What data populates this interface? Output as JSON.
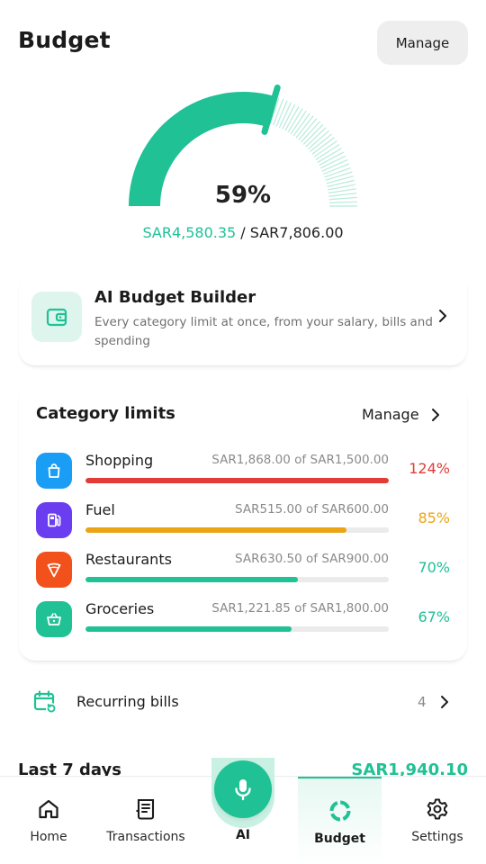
{
  "header": {
    "title": "Budget",
    "manage_label": "Manage"
  },
  "summary": {
    "percent_label": "59%",
    "percent_value": 0.59,
    "spent": "SAR4,580.35",
    "separator": " / ",
    "total": "SAR7,806.00"
  },
  "ai_builder": {
    "icon": "wallet-icon",
    "title": "AI Budget Builder",
    "description": "Every category limit at once, from your salary, bills and spending"
  },
  "categories": {
    "title": "Category limits",
    "manage_label": "Manage",
    "items": [
      {
        "name": "Shopping",
        "amount": "SAR1,868.00 of SAR1,500.00",
        "percent": "124%",
        "progress": 1.0,
        "icon": "shopping-bag-icon",
        "icon_color": "#1a9df5",
        "bar_color": "#e33b36",
        "pct_color": "#e33b36"
      },
      {
        "name": "Fuel",
        "amount": "SAR515.00 of SAR600.00",
        "percent": "85%",
        "progress": 0.86,
        "icon": "fuel-pump-icon",
        "icon_color": "#6a3df0",
        "bar_color": "#eba416",
        "pct_color": "#eba416"
      },
      {
        "name": "Restaurants",
        "amount": "SAR630.50 of SAR900.00",
        "percent": "70%",
        "progress": 0.7,
        "icon": "restaurant-icon",
        "icon_color": "#f2511b",
        "bar_color": "#1fc195",
        "pct_color": "#1fc195"
      },
      {
        "name": "Groceries",
        "amount": "SAR1,221.85 of SAR1,800.00",
        "percent": "67%",
        "progress": 0.68,
        "icon": "grocery-basket-icon",
        "icon_color": "#1fc195",
        "bar_color": "#1fc195",
        "pct_color": "#1fc195"
      }
    ]
  },
  "recurring_bills": {
    "label": "Recurring bills",
    "count": "4",
    "icon": "calendar-repeat-icon"
  },
  "last7": {
    "label": "Last 7 days",
    "amount": "SAR1,940.10"
  },
  "tabbar": {
    "home": "Home",
    "transactions": "Transactions",
    "ai": "AI",
    "budget": "Budget",
    "settings": "Settings"
  },
  "colors": {
    "accent": "#1fc195",
    "danger": "#e33b36",
    "warning": "#eba416"
  }
}
